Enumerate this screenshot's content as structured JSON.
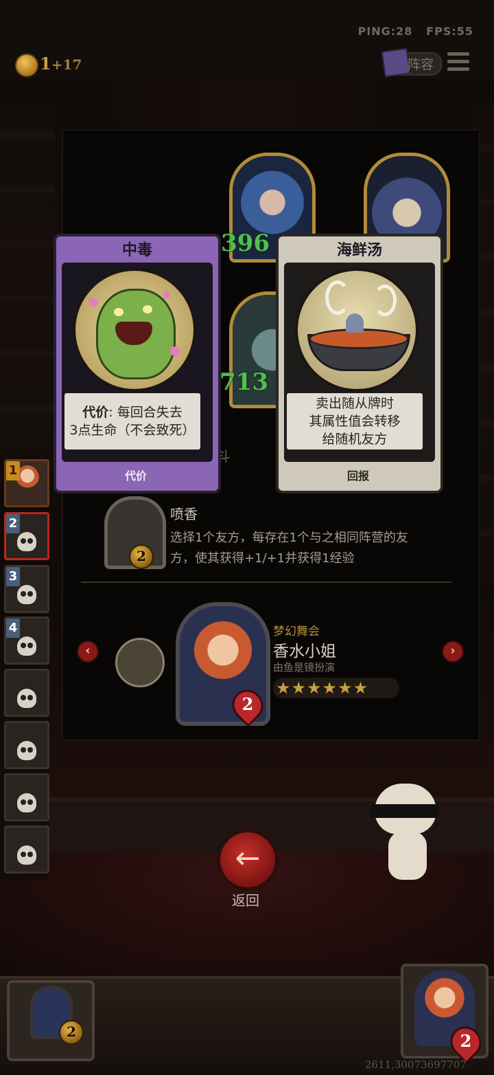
{
  "status": {
    "ping": "PING:28",
    "fps": "FPS:55"
  },
  "currency": {
    "coins": "1",
    "income": "+17"
  },
  "header": {
    "lineup_label": "阵容"
  },
  "rail": {
    "slots": [
      "1",
      "2",
      "3",
      "4"
    ]
  },
  "board": {
    "hero_values": [
      "396",
      "713"
    ],
    "partial_label": "斗"
  },
  "cards": [
    {
      "title": "中毒",
      "desc_bold": "代价",
      "desc_line1": ": 每回合失去",
      "desc_line2": "3点生命（不会致死）",
      "badge": "代价",
      "accent": "#8b66b4",
      "icon": "poison-goblin-icon"
    },
    {
      "title": "海鲜汤",
      "desc_line1": "卖出随从牌时",
      "desc_line2": "其属性值会转移",
      "desc_line3": "给随机友方",
      "badge": "回报",
      "accent": "#cfc9bb",
      "icon": "seafood-soup-icon"
    }
  ],
  "ability": {
    "cost": "2",
    "title": "喷香",
    "desc": "选择1个友方，每存在1个与之相同阵营的友方，使其获得+1/+1并获得1经验"
  },
  "hero": {
    "tribe": "梦幻舞会",
    "name": "香水小姐",
    "actor": "由鱼是镜扮演",
    "stars": "★★★★★★",
    "health": "2"
  },
  "back": {
    "label": "返回",
    "icon": "back-arrow-icon"
  },
  "dock": {
    "left_cost": "2",
    "right_health": "2"
  },
  "coords": "2611,30073697707"
}
